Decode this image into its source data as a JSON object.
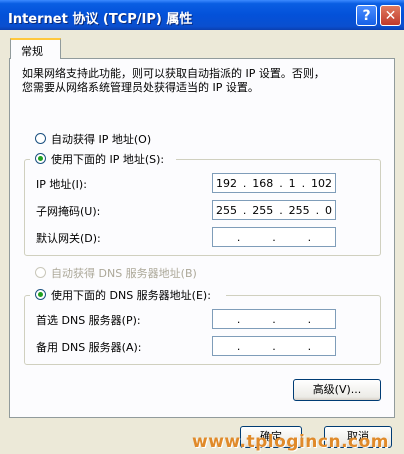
{
  "window": {
    "title": "Internet 协议 (TCP/IP) 属性",
    "help_label": "?",
    "close_label": "✕"
  },
  "tab": {
    "label": "常规"
  },
  "description": "如果网络支持此功能，则可以获取自动指派的 IP 设置。否则，\n您需要从网络系统管理员处获得适当的 IP 设置。",
  "ip": {
    "auto_label": "自动获得 IP 地址(O)",
    "manual_label": "使用下面的 IP 地址(S):",
    "mode": "manual",
    "fields": [
      {
        "label": "IP 地址(I):",
        "value": [
          "192",
          "168",
          "1",
          "102"
        ]
      },
      {
        "label": "子网掩码(U):",
        "value": [
          "255",
          "255",
          "255",
          "0"
        ]
      },
      {
        "label": "默认网关(D):",
        "value": [
          "",
          "",
          "",
          ""
        ]
      }
    ]
  },
  "dns": {
    "auto_label": "自动获得 DNS 服务器地址(B)",
    "manual_label": "使用下面的 DNS 服务器地址(E):",
    "mode": "manual",
    "fields": [
      {
        "label": "首选 DNS 服务器(P):",
        "value": [
          "",
          "",
          "",
          ""
        ]
      },
      {
        "label": "备用 DNS 服务器(A):",
        "value": [
          "",
          "",
          "",
          ""
        ]
      }
    ]
  },
  "buttons": {
    "advanced": "高级(V)...",
    "ok": "确定",
    "cancel": "取消"
  },
  "watermark": "www.tplogincn.com"
}
